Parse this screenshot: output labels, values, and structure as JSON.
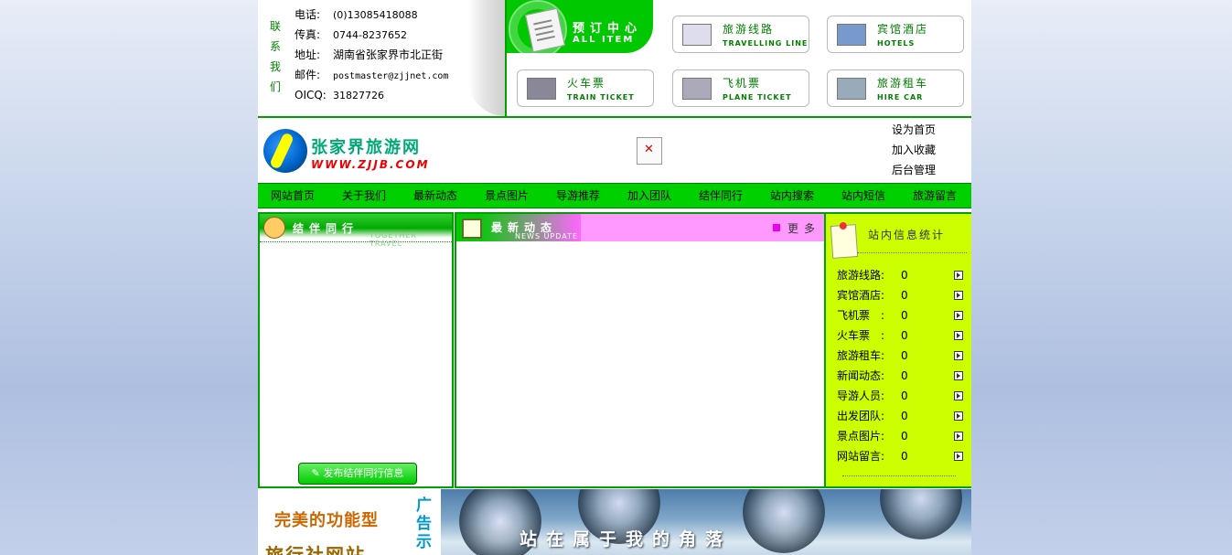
{
  "contact": {
    "side_label": [
      "联",
      "系",
      "我",
      "们"
    ],
    "lines": [
      {
        "key": "电话:",
        "value": "(0)13085418088"
      },
      {
        "key": "传真:",
        "value": "0744-8237652"
      },
      {
        "key": "地址:",
        "value": "湖南省张家界市北正街"
      },
      {
        "key": "邮件:",
        "value": "postmaster@zjjnet.com"
      },
      {
        "key": "OICQ:",
        "value": "31827726"
      }
    ]
  },
  "booking": {
    "title": "预订中心",
    "subtitle": "ALL ITEM",
    "buttons": [
      {
        "cn": "旅游线路",
        "en": "TRAVELLING LINE"
      },
      {
        "cn": "宾馆酒店",
        "en": "HOTELS"
      },
      {
        "cn": "火车票",
        "en": "TRAIN TICKET"
      },
      {
        "cn": "飞机票",
        "en": "PLANE TICKET"
      },
      {
        "cn": "旅游租车",
        "en": "HIRE CAR"
      }
    ]
  },
  "logo": {
    "cn": "张家界旅游网",
    "url": "WWW.ZJJB.COM"
  },
  "broken_image_glyph": "✕",
  "quick_links": [
    "设为首页",
    "加入收藏",
    "后台管理"
  ],
  "nav": [
    "网站首页",
    "关于我们",
    "最新动态",
    "景点图片",
    "导游推荐",
    "加入团队",
    "结伴同行",
    "站内搜索",
    "站内短信",
    "旅游留言"
  ],
  "left_panel": {
    "title": "结伴同行",
    "subtitle": "TOGETHER TRAVEL",
    "button": "发布结伴同行信息"
  },
  "middle_panel": {
    "title": "最新动态",
    "subtitle": "NEWS UPDATE",
    "more": "更多"
  },
  "right_panel": {
    "title": "站内信息统计",
    "stats": [
      {
        "label": "旅游线路:",
        "value": "0"
      },
      {
        "label": "宾馆酒店:",
        "value": "0"
      },
      {
        "label": "飞机票　:",
        "value": "0"
      },
      {
        "label": "火车票　:",
        "value": "0"
      },
      {
        "label": "旅游租车:",
        "value": "0"
      },
      {
        "label": "新闻动态:",
        "value": "0"
      },
      {
        "label": "导游人员:",
        "value": "0"
      },
      {
        "label": "出发团队:",
        "value": "0"
      },
      {
        "label": "景点图片:",
        "value": "0"
      },
      {
        "label": "网站留言:",
        "value": "0"
      }
    ]
  },
  "ad": {
    "line1": "完美的功能型",
    "line2": "旅行社网站",
    "vertical": "广告示",
    "slogan": "站在属于我的角落"
  },
  "colors": {
    "nav_green": "#00d000",
    "border_green": "#00a000",
    "stats_bg": "#ccff00",
    "news_header": "#ff99ff"
  }
}
